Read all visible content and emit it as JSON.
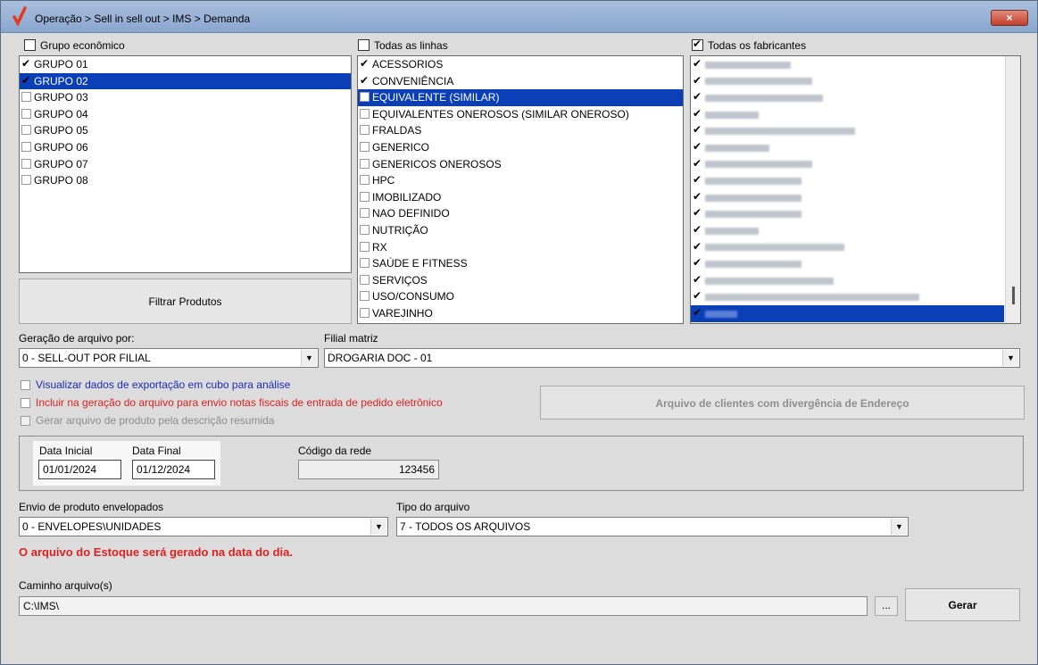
{
  "window": {
    "title": "Operação > Sell in sell out > IMS > Demanda",
    "close_label": "×"
  },
  "groups": {
    "header_label": "Grupo econômico",
    "header_checked": false,
    "items": [
      {
        "label": "GRUPO 01",
        "checked": true
      },
      {
        "label": "GRUPO 02",
        "checked": true,
        "selected": true
      },
      {
        "label": "GRUPO 03",
        "checked": false
      },
      {
        "label": "GRUPO 04",
        "checked": false
      },
      {
        "label": "GRUPO 05",
        "checked": false
      },
      {
        "label": "GRUPO 06",
        "checked": false
      },
      {
        "label": "GRUPO 07",
        "checked": false
      },
      {
        "label": "GRUPO 08",
        "checked": false
      }
    ]
  },
  "lines": {
    "header_label": "Todas as linhas",
    "header_checked": false,
    "items": [
      {
        "label": "ACESSORIOS",
        "checked": true
      },
      {
        "label": "CONVENIÊNCIA",
        "checked": true
      },
      {
        "label": "EQUIVALENTE (SIMILAR)",
        "checked": false,
        "selected": true
      },
      {
        "label": "EQUIVALENTES ONEROSOS (SIMILAR ONEROSO)",
        "checked": false
      },
      {
        "label": "FRALDAS",
        "checked": false
      },
      {
        "label": "GENERICO",
        "checked": false
      },
      {
        "label": "GENERICOS ONEROSOS",
        "checked": false
      },
      {
        "label": "HPC",
        "checked": false
      },
      {
        "label": "IMOBILIZADO",
        "checked": false
      },
      {
        "label": "NAO DEFINIDO",
        "checked": false
      },
      {
        "label": "NUTRIÇÃO",
        "checked": false
      },
      {
        "label": "RX",
        "checked": false
      },
      {
        "label": "SAÚDE E FITNESS",
        "checked": false
      },
      {
        "label": "SERVIÇOS",
        "checked": false
      },
      {
        "label": "USO/CONSUMO",
        "checked": false
      },
      {
        "label": "VAREJINHO",
        "checked": false
      }
    ]
  },
  "manufacturers": {
    "header_label": "Todas os fabricantes",
    "header_checked": true,
    "items": [
      {
        "checked": true,
        "redacted_width": 0.4
      },
      {
        "checked": true,
        "redacted_width": 0.5
      },
      {
        "checked": true,
        "redacted_width": 0.55
      },
      {
        "checked": true,
        "redacted_width": 0.25
      },
      {
        "checked": true,
        "redacted_width": 0.7
      },
      {
        "checked": true,
        "redacted_width": 0.3
      },
      {
        "checked": true,
        "redacted_width": 0.5
      },
      {
        "checked": true,
        "redacted_width": 0.45
      },
      {
        "checked": true,
        "redacted_width": 0.45
      },
      {
        "checked": true,
        "redacted_width": 0.45
      },
      {
        "checked": true,
        "redacted_width": 0.25
      },
      {
        "checked": true,
        "redacted_width": 0.65
      },
      {
        "checked": true,
        "redacted_width": 0.45
      },
      {
        "checked": true,
        "redacted_width": 0.6
      },
      {
        "checked": true,
        "redacted_width": 1.0
      },
      {
        "checked": true,
        "redacted_width": 0.15,
        "selected": true
      }
    ]
  },
  "filter_button": "Filtrar Produtos",
  "geracao": {
    "label": "Geração de arquivo por:",
    "value": "0 - SELL-OUT POR FILIAL"
  },
  "filial": {
    "label": "Filial matriz",
    "value": "DROGARIA DOC - 01"
  },
  "options": [
    {
      "label": "Visualizar dados de exportação em cubo para análise",
      "color": "#1a2bb8",
      "checked": false,
      "disabled": false
    },
    {
      "label": "Incluir na geração do arquivo para envio notas fiscais de entrada de pedido eletrônico",
      "color": "#e02020",
      "checked": false,
      "disabled": false
    },
    {
      "label": "Gerar arquivo de produto pela descrição resumida",
      "color": "#8c8c8c",
      "checked": false,
      "disabled": true
    }
  ],
  "divergence_button": "Arquivo de clientes com divergência de Endereço",
  "dates": {
    "start_label": "Data Inicial",
    "start_value": "01/01/2024",
    "end_label": "Data Final",
    "end_value": "01/12/2024"
  },
  "network": {
    "label": "Código da rede",
    "value": "123456"
  },
  "envio": {
    "label": "Envio de produto envelopados",
    "value": "0 - ENVELOPES\\UNIDADES"
  },
  "tipo": {
    "label": "Tipo do arquivo",
    "value": "7 - TODOS OS ARQUIVOS"
  },
  "warning": "O arquivo do Estoque será gerado na data do dia.",
  "path": {
    "label": "Caminho arquivo(s)",
    "value": "C:\\IMS\\",
    "browse_label": "..."
  },
  "generate_button": "Gerar",
  "colors": {
    "selection": "#0a3fb8",
    "warning": "#e02020"
  }
}
